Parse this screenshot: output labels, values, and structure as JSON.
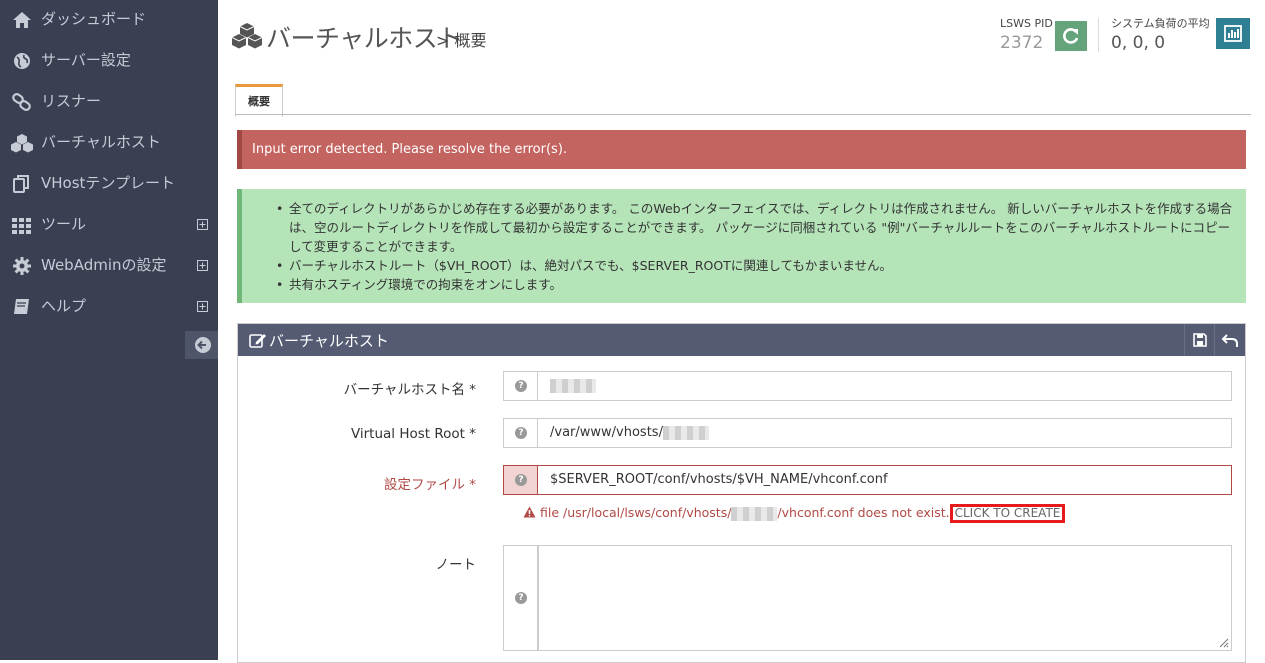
{
  "sidebar": {
    "items": [
      {
        "label": "ダッシュボード",
        "icon": "home-icon"
      },
      {
        "label": "サーバー設定",
        "icon": "globe-icon"
      },
      {
        "label": "リスナー",
        "icon": "link-icon"
      },
      {
        "label": "バーチャルホスト",
        "icon": "cubes-icon"
      },
      {
        "label": "VHostテンプレート",
        "icon": "copy-icon"
      },
      {
        "label": "ツール",
        "icon": "grid-icon",
        "expandable": true
      },
      {
        "label": "WebAdminの設定",
        "icon": "gear-icon",
        "expandable": true
      },
      {
        "label": "ヘルプ",
        "icon": "book-icon",
        "expandable": true
      }
    ]
  },
  "header": {
    "title": "バーチャルホスト",
    "subtitle": "> 概要",
    "pid_label": "LSWS PID",
    "pid_value": "2372",
    "load_label": "システム負荷の平均",
    "load_value": "0, 0, 0"
  },
  "tabs": [
    {
      "label": "概要",
      "active": true
    }
  ],
  "alerts": {
    "error": "Input error detected. Please resolve the error(s).",
    "info": [
      "全てのディレクトリがあらかじめ存在する必要があります。 このWebインターフェイスでは、ディレクトリは作成されません。 新しいバーチャルホストを作成する場合は、空のルートディレクトリを作成して最初から設定することができます。 パッケージに同梱されている \"例\"バーチャルルートをこのバーチャルホストルートにコピーして変更することができます。",
      "バーチャルホストルート（$VH_ROOT）は、絶対パスでも、$SERVER_ROOTに関連してもかまいません。",
      "共有ホスティング環境での拘束をオンにします。"
    ]
  },
  "panel": {
    "title": "バーチャルホスト",
    "fields": {
      "vhost_name": {
        "label": "バーチャルホスト名 *",
        "value": ""
      },
      "vhost_root": {
        "label": "Virtual Host Root *",
        "value": "/var/www/vhosts/"
      },
      "config_file": {
        "label": "設定ファイル *",
        "value": "$SERVER_ROOT/conf/vhosts/$VH_NAME/vhconf.conf"
      },
      "note": {
        "label": "ノート",
        "value": ""
      }
    },
    "error": {
      "prefix": "file /usr/local/lsws/conf/vhosts/",
      "suffix": "/vhconf.conf does not exist.",
      "link": "CLICK TO CREATE"
    }
  },
  "colors": {
    "sidebar_bg": "#3a3f51",
    "panel_header": "#555b73",
    "error_bg": "#c46460",
    "info_bg": "#b6e4b9",
    "restart_btn": "#65a37a",
    "stats_btn": "#2e7f93",
    "tab_accent": "#e89a3c"
  }
}
